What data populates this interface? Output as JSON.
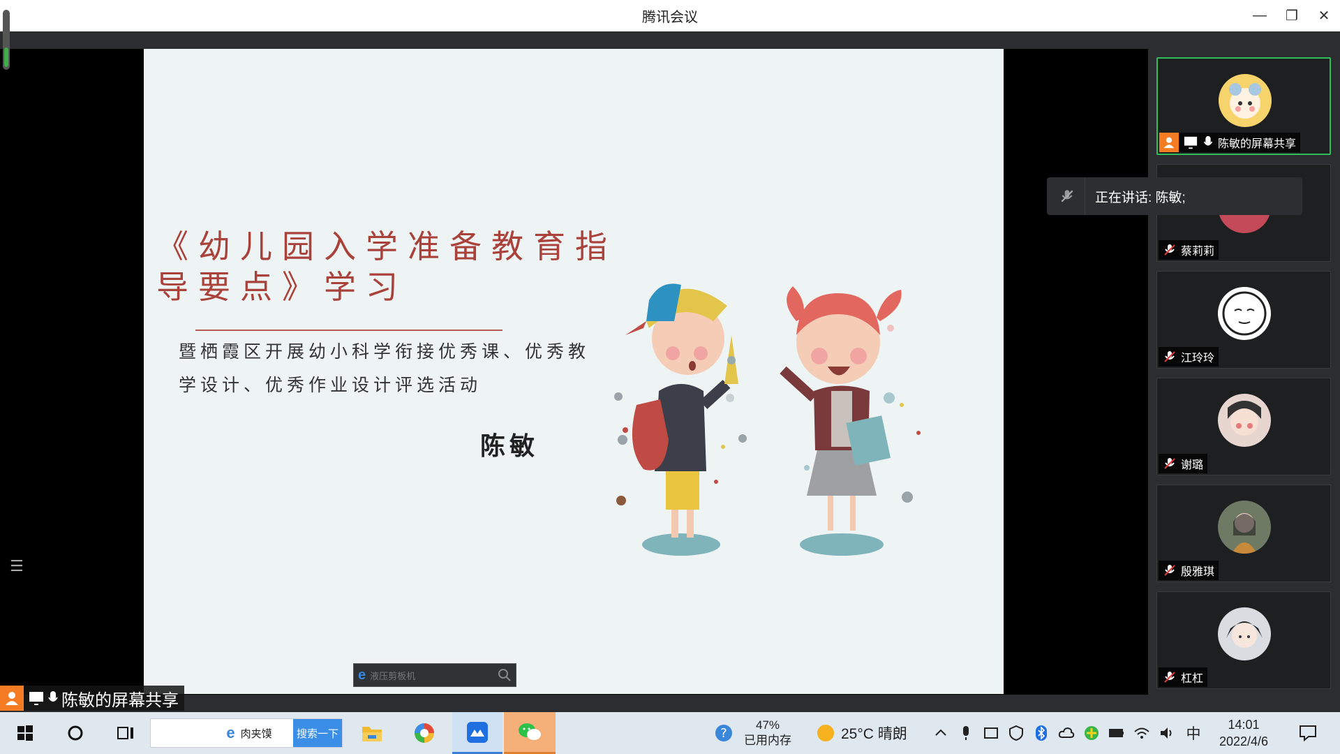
{
  "window": {
    "title": "腾讯会议",
    "minimize_glyph": "—",
    "maximize_glyph": "❐",
    "close_glyph": "✕"
  },
  "slide": {
    "title": "《幼儿园入学准备教育指导要点》学习",
    "subtitle": "暨栖霞区开展幼小科学衔接优秀课、优秀教学设计、优秀作业设计评选活动",
    "author": "陈敏"
  },
  "browser_search": {
    "placeholder": "液压剪板机"
  },
  "share_label": {
    "text": "陈敏的屏幕共享"
  },
  "speaking": {
    "text": "正在讲话: 陈敏;"
  },
  "participants": [
    {
      "name": "陈敏的屏幕共享",
      "active": true,
      "muted": false,
      "avatar": "cartoon-bear-avatar"
    },
    {
      "name": "蔡莉莉",
      "active": false,
      "muted": true,
      "avatar": "photo-avatar"
    },
    {
      "name": "江玲玲",
      "active": false,
      "muted": true,
      "avatar": "line-drawing-avatar"
    },
    {
      "name": "谢璐",
      "active": false,
      "muted": true,
      "avatar": "photo-avatar"
    },
    {
      "name": "殷雅琪",
      "active": false,
      "muted": true,
      "avatar": "photo-avatar"
    },
    {
      "name": "杠杠",
      "active": false,
      "muted": true,
      "avatar": "photo-avatar"
    }
  ],
  "taskbar": {
    "search_text": "肉夹馍",
    "search_button": "搜索一下",
    "memory_percent": "47%",
    "memory_label": "已用内存",
    "weather": "25°C  晴朗",
    "ime": "中",
    "time": "14:01",
    "date": "2022/4/6"
  },
  "colors": {
    "active_border": "#2fbf5a",
    "share_orange": "#f57c22",
    "slide_title": "#a9423b",
    "search_button": "#3a8ee6"
  }
}
